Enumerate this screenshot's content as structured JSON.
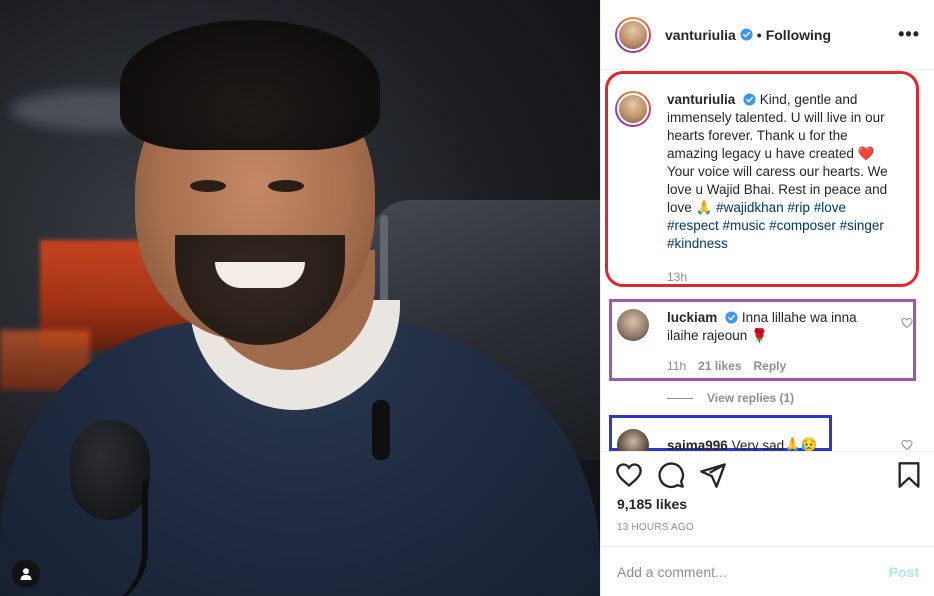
{
  "post": {
    "author": "vanturiulia",
    "follow_status": "Following",
    "more_icon": "more-horizontal-icon"
  },
  "caption": {
    "username": "vanturiulia",
    "text_1": "Kind, gentle and immensely talented. U will live in our hearts forever. Thank u for the amazing legacy u have created",
    "emoji_heart": "❤️",
    "text_2": "Your voice will caress our hearts. We love u Wajid Bhai. Rest in peace and love",
    "emoji_pray": "🙏",
    "hashtags": [
      "#wajidkhan",
      "#rip",
      "#love",
      "#respect",
      "#music",
      "#composer",
      "#singer",
      "#kindness"
    ],
    "time": "13h"
  },
  "comments": [
    {
      "username": "luckiam",
      "text": "Inna lillahe wa inna ilaihe rajeoun",
      "emoji": "🌹",
      "time": "11h",
      "likes": "21 likes",
      "reply_label": "Reply",
      "view_replies": "View replies (1)"
    },
    {
      "username": "saima996",
      "text": "Very sad",
      "emoji": "🙏😥"
    }
  ],
  "actions": {
    "likes": "9,185 likes",
    "timestamp": "13 HOURS AGO",
    "icons": [
      "heart-icon",
      "comment-icon",
      "share-icon",
      "bookmark-icon"
    ]
  },
  "add_comment": {
    "placeholder": "Add a comment...",
    "post_label": "Post"
  },
  "colors": {
    "verified": "#3897f0",
    "hashtag": "#00376b",
    "caption_highlight": "#e0262f",
    "comment1_highlight": "#9b59b6",
    "comment2_highlight": "#2c38c4",
    "post_button": "#b2dffc"
  }
}
